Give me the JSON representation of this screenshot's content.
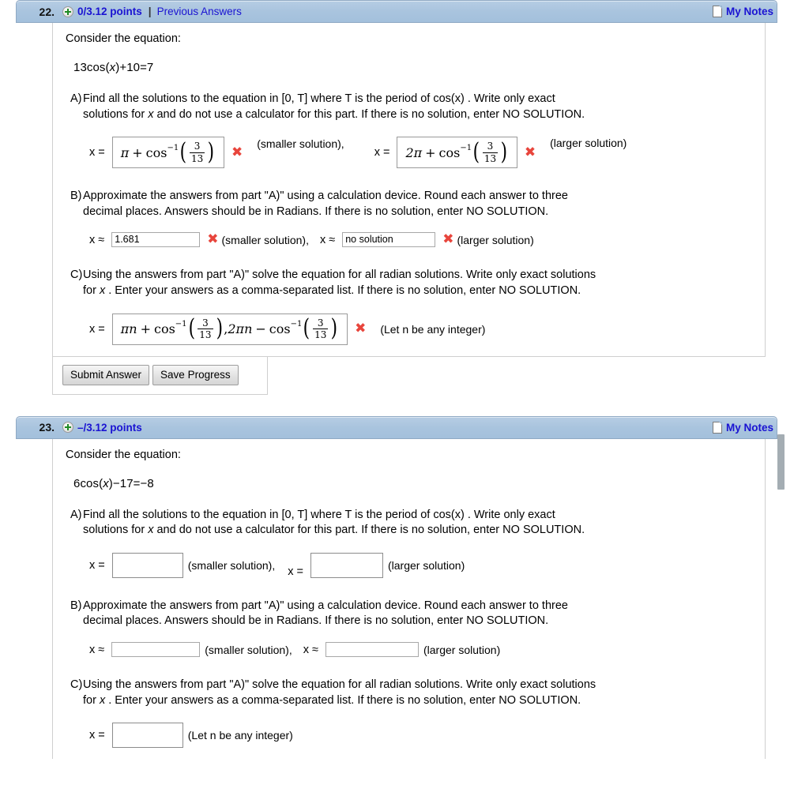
{
  "icons": {
    "expand": "plus-circle-icon",
    "notes": "note-page-icon",
    "incorrect": "red-x-icon"
  },
  "questions": [
    {
      "number": "22.",
      "points": "0/3.12 points",
      "separator": "|",
      "previous_answers": "Previous Answers",
      "my_notes": "My Notes",
      "consider": "Consider the equation:",
      "equation_pre": "13cos(",
      "equation_var": "x",
      "equation_post": ")+10=7",
      "parts": [
        {
          "letter": "A)",
          "text_1": "Find all the solutions to the equation in  [0, T]  where  T  is the period of  cos(x) . Write only exact",
          "text_2a": "solutions for  ",
          "text_2var": "x",
          "text_2b": "  and do not use a calculator for this part. If there is no solution, enter NO SOLUTION."
        },
        {
          "letter": "B)",
          "text_1": "Approximate the answers from part \"A)\" using a calculation device. Round each answer to three",
          "text_2a": "decimal places. Answers should be in Radians. If there is no solution, enter NO SOLUTION.",
          "text_2var": "",
          "text_2b": ""
        },
        {
          "letter": "C)",
          "text_1": "Using the answers from part \"A)\" solve the equation for all radian solutions. Write only exact solutions",
          "text_2a": "for  ",
          "text_2var": "x",
          "text_2b": " . Enter your answers as a comma-separated list. If there is no solution, enter NO SOLUTION."
        }
      ],
      "answer_a": {
        "label_1": "x =",
        "label_2": "x =",
        "math_1": {
          "lead": "π",
          "op": "+",
          "func": "cos",
          "exp": "−1",
          "num": "3",
          "den": "13"
        },
        "math_2": {
          "lead": "2π",
          "op": "+",
          "func": "cos",
          "exp": "−1",
          "num": "3",
          "den": "13"
        },
        "hint_1": "(smaller solution),",
        "hint_2": "(larger solution)",
        "mark_1": "✖",
        "mark_2": "✖"
      },
      "answer_b": {
        "label_1": "x ≈",
        "value_1": "1.681",
        "mark_1": "✖",
        "hint_1": "(smaller solution),",
        "label_2": "x ≈",
        "value_2": "no solution",
        "mark_2": "✖",
        "hint_2": "(larger solution)"
      },
      "answer_c": {
        "label": "x =",
        "math": {
          "lead_pi": "π",
          "lead_n": "n",
          "op1": "+",
          "func1": "cos",
          "exp1": "−1",
          "num1": "3",
          "den1": "13",
          "comma": ",",
          "mid_pi": "2π",
          "mid_n": "n",
          "op2": "−",
          "func2": "cos",
          "exp2": "−1",
          "num2": "3",
          "den2": "13"
        },
        "mark": "✖",
        "hint": "(Let n be any integer)"
      },
      "buttons": {
        "submit": "Submit Answer",
        "save": "Save Progress"
      }
    },
    {
      "number": "23.",
      "points": "–/3.12 points",
      "separator": "",
      "previous_answers": "",
      "my_notes": "My Notes",
      "consider": "Consider the equation:",
      "equation_pre": "6cos(",
      "equation_var": "x",
      "equation_post": ")−17=−8",
      "parts": [
        {
          "letter": "A)",
          "text_1": "Find all the solutions to the equation in  [0, T]  where  T  is the period of  cos(x) . Write only exact",
          "text_2a": "solutions for  ",
          "text_2var": "x",
          "text_2b": "  and do not use a calculator for this part. If there is no solution, enter NO SOLUTION."
        },
        {
          "letter": "B)",
          "text_1": "Approximate the answers from part \"A)\" using a calculation device. Round each answer to three",
          "text_2a": "decimal places. Answers should be in Radians. If there is no solution, enter NO SOLUTION.",
          "text_2var": "",
          "text_2b": ""
        },
        {
          "letter": "C)",
          "text_1": "Using the answers from part \"A)\" solve the equation for all radian solutions. Write only exact solutions",
          "text_2a": "for  ",
          "text_2var": "x",
          "text_2b": " . Enter your answers as a comma-separated list. If there is no solution, enter NO SOLUTION."
        }
      ],
      "answer_a": {
        "label_1": "x =",
        "value_1": "",
        "hint_1": "(smaller solution),",
        "label_2": "x =",
        "value_2": "",
        "hint_2": "(larger solution)"
      },
      "answer_b": {
        "label_1": "x ≈",
        "value_1": "",
        "hint_1": "(smaller solution),",
        "label_2": "x ≈",
        "value_2": "",
        "hint_2": "(larger solution)"
      },
      "answer_c": {
        "label": "x =",
        "value": "",
        "hint": "(Let n be any integer)"
      }
    }
  ],
  "colors": {
    "header_bg": "#a9c4de",
    "link": "#1a13d2",
    "incorrect": "#e8453c",
    "plus_green": "#1f8b24"
  }
}
